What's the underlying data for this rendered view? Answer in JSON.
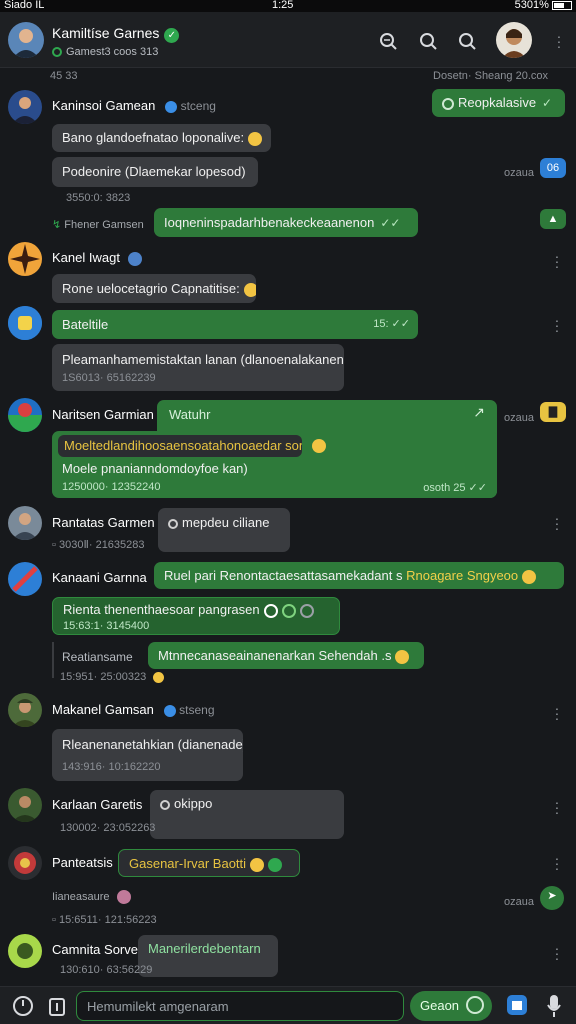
{
  "status": {
    "left": "Siado IL",
    "time": "1:25",
    "right": "5301%"
  },
  "header": {
    "title": "Kamiltíse Garnes",
    "subtitle": "Gamest3 coos 313"
  },
  "chat": {
    "top_meta_left": "45 33",
    "top_meta_right": "Dosetn· Sheang 20.cox",
    "msg1": {
      "name": "Kaninsoi Gamean",
      "tag": "stceng",
      "reply": "Reopkalasive",
      "b1": "Bano glandoefnatao loponalive:",
      "b2": "Podeonire (Dlaemekar lopesod)",
      "time": "3550:0: 3823",
      "side_label": "ozaua",
      "side_icon": "06"
    },
    "msg2": {
      "from": "Fhener Gamsen",
      "text": "Ioqneninspadarhbenakeckeaanenon"
    },
    "msg3": {
      "name": "Kanel Iwagt",
      "b1": "Rone uelocetagrio Capnatitise:"
    },
    "msg4": {
      "b1": "Bateltile",
      "b1_time": "15:",
      "b2": "Pleamanhamemistaktan lanan (dlanoenalakanent",
      "b2_time": "1S6013· 65162239"
    },
    "msg5": {
      "name": "Naritsen Garmian",
      "card_title": "Watuhr",
      "card_line1": "Moeltedlandihoosaensoatahonoaedar sony",
      "card_line2": "Moele pnanianndomdoyfoe kan)",
      "card_time": "1250000· 12352240",
      "card_right": "osoth 25",
      "side_label": "ozaua"
    },
    "msg6": {
      "name": "Rantatas Garmen",
      "b1": "mepdeu ciliane",
      "time": "3030Ⅱ· 21635283"
    },
    "msg7": {
      "name": "Kanaani Garnna",
      "reply": "Ruel pari Renontactaesattasamekadant s",
      "reply_accent": "Rnoagare Sngyeoo",
      "b1": "Rienta thenenthaesoar pangrasen",
      "b1_time": "15:63:1· 3145400",
      "sub_label": "Reatiansame",
      "b2": "Mtnnecanaseainanenarkan Sehendah .s",
      "b2_time": "15:951· 25:00323"
    },
    "msg8": {
      "name": "Makanel Gamsan",
      "tag": "stseng",
      "b1": "Rleanenanetahkian (dianenade)",
      "time": "143:916· 10:162220"
    },
    "msg9": {
      "name": "Karlaan Garetis",
      "b1": "okippo",
      "time": "130002· 23:052263"
    },
    "msg10": {
      "name": "Panteatsis",
      "b1": "Gasenar-Irvar Baotti",
      "sub": "Iianeasaure",
      "time": "15:6511· 121:56223"
    },
    "msg11": {
      "name": "Camnita Sorve",
      "b1": "Manerilerdebentarn",
      "time": "130:610· 63:56229"
    }
  },
  "composer": {
    "placeholder": "Hemumilekt amgenaram",
    "send": "Geaon"
  },
  "colors": {
    "accent": "#2e7a3a",
    "bg": "#17191c",
    "bubble": "#3a3c40"
  }
}
